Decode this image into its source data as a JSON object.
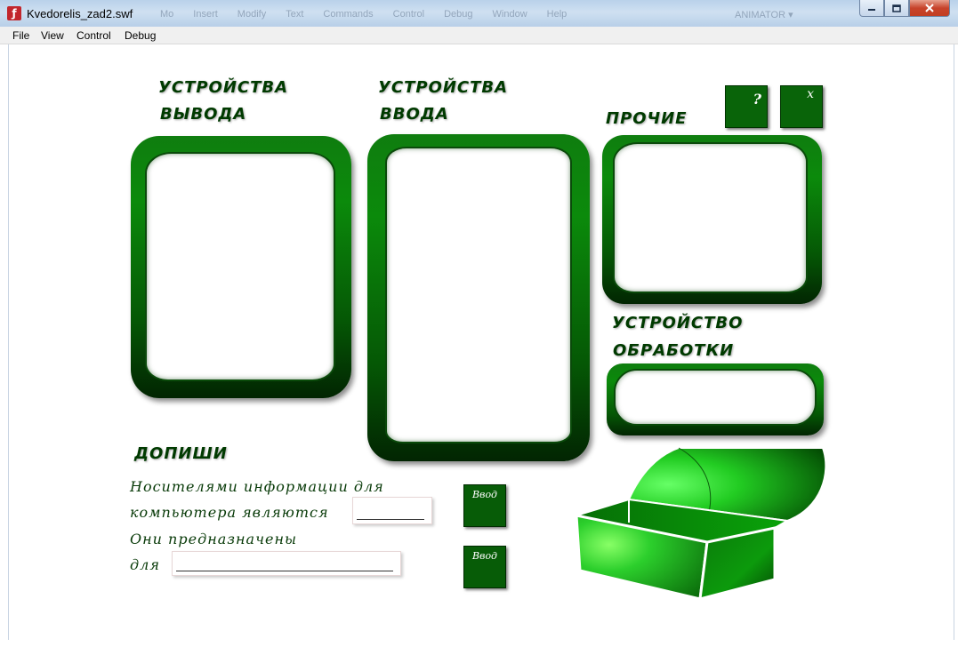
{
  "window": {
    "title": "Kvedorelis_zad2.swf",
    "ghost_menu": [
      "Mo",
      "Insert",
      "Modify",
      "Text",
      "Commands",
      "Control",
      "Debug",
      "Window",
      "Help"
    ],
    "ghost_user": "ANIMATOR ▾",
    "icons": {
      "app": "flash-player-icon",
      "minimize": "minimize-icon",
      "maximize": "maximize-icon",
      "close": "close-icon"
    }
  },
  "menu": [
    "File",
    "View",
    "Control",
    "Debug"
  ],
  "headings": {
    "output": [
      "УСТРОЙСТВА",
      "ВЫВОДА"
    ],
    "input": [
      "УСТРОЙСТВА",
      "ВВОДА"
    ],
    "other": "ПРОЧИЕ",
    "processing": [
      "УСТРОЙСТВО",
      "ОБРАБОТКИ"
    ],
    "fill_in": "ДОПИШИ"
  },
  "buttons": {
    "help": "?",
    "close": "x",
    "enter1": "Ввод",
    "enter2": "Ввод"
  },
  "sentences": {
    "s1_line1": "Носителями информации для",
    "s1_line2": "компьютера являются",
    "s2_line1": "Они предназначены",
    "s2_line2": "для"
  },
  "colors": {
    "frame_green": "#0b8a0b",
    "dark_green": "#022502",
    "chest_green": "#33ff33",
    "heading_text": "#003a00"
  }
}
